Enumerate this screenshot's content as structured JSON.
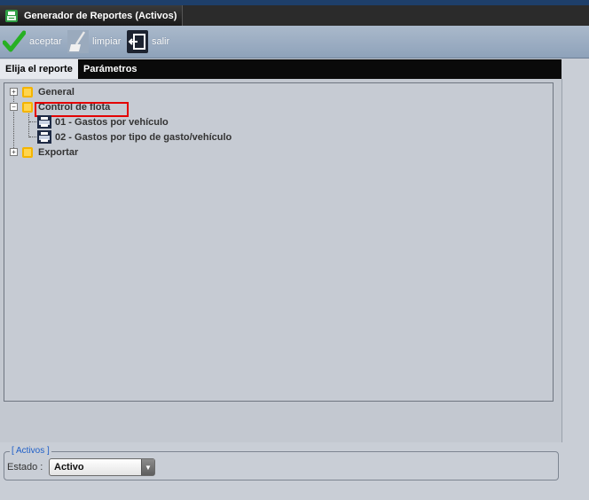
{
  "window": {
    "title": "Generador de Reportes (Activos)"
  },
  "toolbar": {
    "accept_label": "aceptar",
    "clear_label": "limpiar",
    "exit_label": "salir"
  },
  "tabs": [
    {
      "label": "Elija el reporte",
      "active": true
    },
    {
      "label": "Parámetros",
      "active": false
    }
  ],
  "tree": {
    "general": "General",
    "control_flota": "Control de flota",
    "report_01": "01 - Gastos por vehículo",
    "report_02": "02 - Gastos por tipo de gasto/vehículo",
    "exportar": "Exportar"
  },
  "filter": {
    "legend": "[ Activos ]",
    "estado_label": "Estado :",
    "estado_value": "Activo"
  },
  "colors": {
    "accent": "#1f5fc8",
    "highlight": "#e30000",
    "folder": "#f4b400"
  }
}
